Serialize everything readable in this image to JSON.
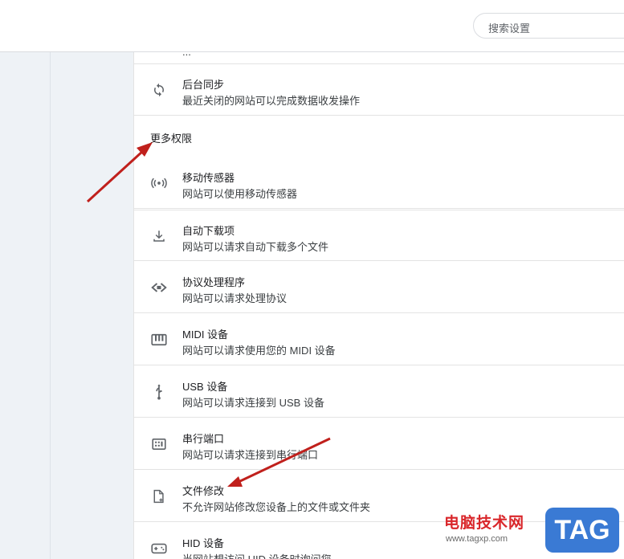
{
  "search": {
    "placeholder": "搜索设置"
  },
  "cut_off_text": "...",
  "background_sync": {
    "title": "后台同步",
    "desc": "最近关闭的网站可以完成数据收发操作"
  },
  "section_title": "更多权限",
  "items": [
    {
      "title": "移动传感器",
      "desc": "网站可以使用移动传感器",
      "icon": "sensors-icon"
    },
    {
      "title": "自动下载项",
      "desc": "网站可以请求自动下载多个文件",
      "icon": "download-icon"
    },
    {
      "title": "协议处理程序",
      "desc": "网站可以请求处理协议",
      "icon": "protocol-handler-icon"
    },
    {
      "title": "MIDI 设备",
      "desc": "网站可以请求使用您的 MIDI 设备",
      "icon": "midi-icon"
    },
    {
      "title": "USB 设备",
      "desc": "网站可以请求连接到 USB 设备",
      "icon": "usb-icon"
    },
    {
      "title": "串行端口",
      "desc": "网站可以请求连接到串行端口",
      "icon": "serial-port-icon"
    },
    {
      "title": "文件修改",
      "desc": "不允许网站修改您设备上的文件或文件夹",
      "icon": "file-edit-icon"
    },
    {
      "title": "HID 设备",
      "desc": "当网站想访问 HID 设备时询问您",
      "icon": "hid-device-icon"
    }
  ],
  "watermark": {
    "text": "电脑技术网",
    "url": "www.tagxp.com",
    "badge": "TAG"
  },
  "colors": {
    "annotation_arrow": "#c0201c",
    "sidebar_bg": "#eef2f6",
    "divider": "#e3e3e3",
    "watermark_red": "#d9262a",
    "tag_blue": "#3a7ad4"
  }
}
